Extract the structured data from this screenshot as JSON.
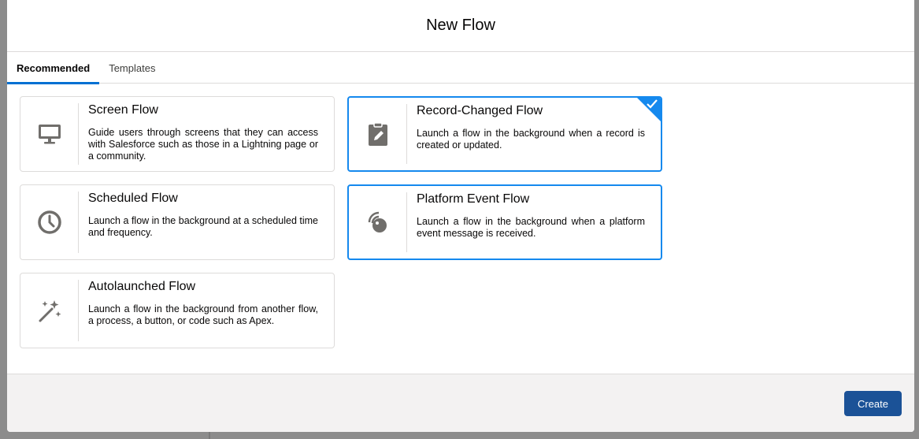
{
  "modal": {
    "title": "New Flow"
  },
  "tabs": [
    {
      "label": "Recommended",
      "active": true
    },
    {
      "label": "Templates",
      "active": false
    }
  ],
  "cards": [
    {
      "title": "Screen Flow",
      "description": "Guide users through screens that they can access with Salesforce such as those in a Lightning page or a community.",
      "icon": "monitor-icon",
      "selected": false
    },
    {
      "title": "Record-Changed Flow",
      "description": "Launch a flow in the background when a record is created or updated.",
      "icon": "clipboard-edit-icon",
      "selected": true
    },
    {
      "title": "Scheduled Flow",
      "description": "Launch a flow in the background at a scheduled time and frequency.",
      "icon": "clock-icon",
      "selected": false
    },
    {
      "title": "Platform Event Flow",
      "description": "Launch a flow in the background when a platform event message is received.",
      "icon": "broadcast-icon",
      "selected": false
    },
    {
      "title": "Autolaunched Flow",
      "description": "Launch a flow in the background from another flow, a process, a button, or code such as Apex.",
      "icon": "magic-wand-icon",
      "selected": false
    }
  ],
  "footer": {
    "create_label": "Create"
  },
  "colors": {
    "accent": "#1589ee",
    "button": "#1b5297",
    "tab_underline": "#0070d2"
  }
}
